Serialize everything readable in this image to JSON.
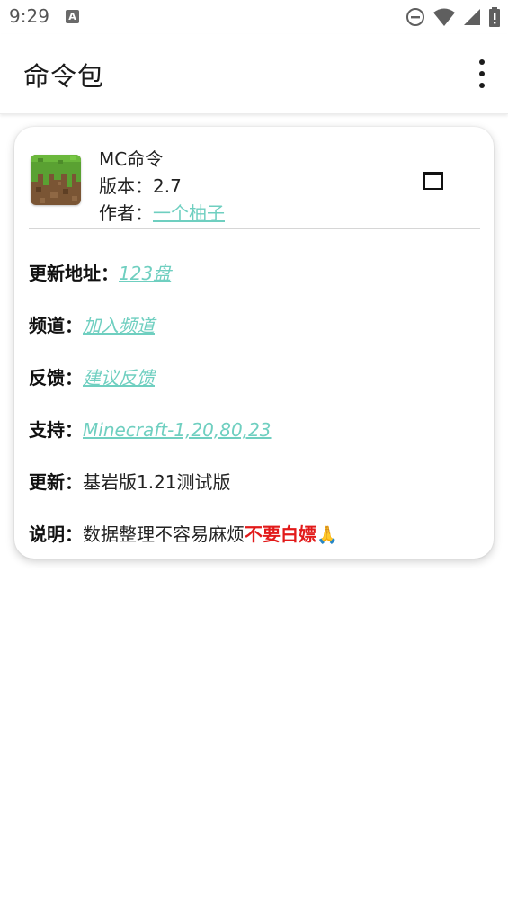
{
  "status_bar": {
    "time": "9:29",
    "a_icon_letter": "A",
    "icons": [
      "a-notification-icon",
      "dnd-icon",
      "wifi-icon",
      "signal-icon",
      "battery-icon"
    ]
  },
  "app_bar": {
    "title": "命令包",
    "menu_icon": "more-vert-icon"
  },
  "pack": {
    "name": "MC命令",
    "version_label": "版本：",
    "version_value": "2.7",
    "author_label": "作者：",
    "author_value": "一个柚子",
    "icon": "grass-block-icon",
    "open_icon": "window-icon"
  },
  "info": {
    "update_url": {
      "label": "更新地址：",
      "value": "123盘"
    },
    "channel": {
      "label": "频道：",
      "value": "加入频道"
    },
    "feedback": {
      "label": "反馈：",
      "value": "建议反馈"
    },
    "support": {
      "label": "支持：",
      "value": "Minecraft-1,20,80,23"
    },
    "update": {
      "label": "更新：",
      "value": "基岩版1.21测试版"
    },
    "description": {
      "label": "说明：",
      "text": "数据整理不容易麻烦",
      "warning": "不要白嫖",
      "emoji": "🙏"
    }
  },
  "colors": {
    "link": "#6fcfc0",
    "warning": "#e21a1a",
    "text": "#222222"
  }
}
